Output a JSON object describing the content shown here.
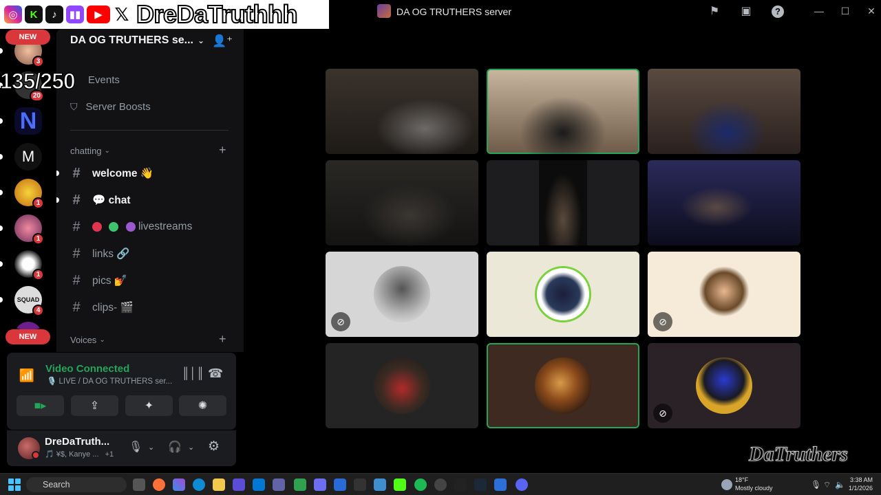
{
  "overlay": {
    "brand_name": "DreDaTruthhh",
    "counter": "135/250",
    "new_top": "NEW",
    "new_bottom": "NEW",
    "watermark": "DaTruthers",
    "social_icons": [
      "instagram-icon",
      "kick-icon",
      "tiktok-icon",
      "twitch-icon",
      "youtube-icon",
      "x-icon"
    ]
  },
  "titlebar": {
    "title": "DA OG TRUTHERS server",
    "icons": [
      "flag-icon",
      "inbox-icon",
      "help-icon"
    ]
  },
  "rail": {
    "servers": [
      {
        "name": "server-1",
        "badge": "3"
      },
      {
        "name": "server-2",
        "badge": "20"
      },
      {
        "name": "server-n",
        "badge": ""
      },
      {
        "name": "server-m",
        "badge": ""
      },
      {
        "name": "server-dbz",
        "badge": "1"
      },
      {
        "name": "server-anime",
        "badge": "1"
      },
      {
        "name": "server-bearded",
        "badge": "1"
      },
      {
        "name": "server-squad",
        "badge": "4"
      }
    ]
  },
  "sidebar": {
    "server_name": "DA OG TRUTHERS se...",
    "events_label": "Events",
    "boosts_label": "Server Boosts",
    "categories": [
      {
        "label": "chatting"
      },
      {
        "label": "Voices"
      }
    ],
    "channels": [
      {
        "label": "welcome 👋",
        "unread": true
      },
      {
        "label": "💬 chat",
        "unread": true
      },
      {
        "label": "livestreams",
        "unread": false
      },
      {
        "label": "links 🔗",
        "unread": false
      },
      {
        "label": "pics 💅",
        "unread": false
      },
      {
        "label": "clips- 🎬",
        "unread": false
      }
    ]
  },
  "voice": {
    "status": "Video Connected",
    "channel": "🎙️ LIVE / DA OG TRUTHERS ser..."
  },
  "user": {
    "name": "DreDaTruth...",
    "activity": "🎵 ¥$, Kanye ...",
    "extra": "+1"
  },
  "grid": {
    "tiles": [
      {
        "kind": "camera",
        "speaking": false,
        "bg": "#2a2521"
      },
      {
        "kind": "camera",
        "speaking": true,
        "bg": "#6a5a4a"
      },
      {
        "kind": "camera",
        "speaking": false,
        "bg": "#3a2f2a"
      },
      {
        "kind": "camera",
        "speaking": false,
        "bg": "#1c1b1a"
      },
      {
        "kind": "camera",
        "speaking": false,
        "bg": "#161616"
      },
      {
        "kind": "camera",
        "speaking": false,
        "bg": "#14122a"
      },
      {
        "kind": "avatar",
        "speaking": false,
        "bg": "#d6d6d6",
        "muted": true
      },
      {
        "kind": "avatar",
        "speaking": false,
        "bg": "#ece8d8",
        "muted": false
      },
      {
        "kind": "avatar",
        "speaking": false,
        "bg": "#f6ead8",
        "muted": true
      },
      {
        "kind": "avatar",
        "speaking": false,
        "bg": "#242424",
        "muted": false
      },
      {
        "kind": "avatar",
        "speaking": true,
        "bg": "#3f2a22",
        "muted": false
      },
      {
        "kind": "avatar",
        "speaking": false,
        "bg": "#2b2228",
        "muted": true
      }
    ]
  },
  "taskbar": {
    "search_placeholder": "Search",
    "weather_temp": "18°F",
    "weather_desc": "Mostly cloudy",
    "time": "3:38 AM",
    "date": "1/1/2026"
  },
  "colors": {
    "accent_green": "#23a55a",
    "badge_red": "#da373c",
    "sidebar_bg": "#121214"
  }
}
